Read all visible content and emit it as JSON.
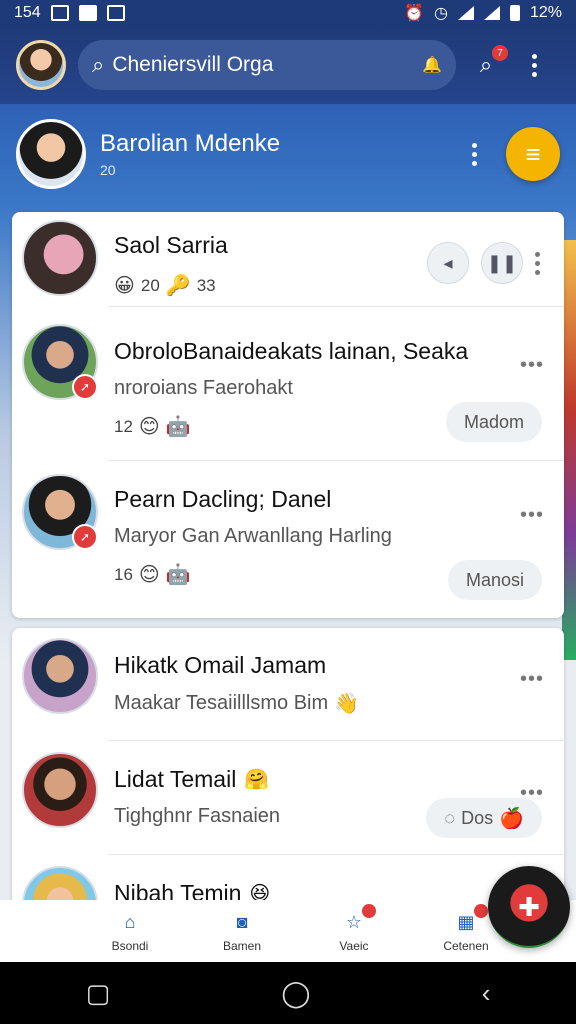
{
  "status_bar": {
    "time": "154",
    "battery_text": "12%"
  },
  "header": {
    "search_text": "Cheniersvill Orga",
    "notification_count": "7"
  },
  "profile": {
    "name": "Barolian Mdenke",
    "subtitle": "20"
  },
  "chats": [
    {
      "title": "Saol Sarria",
      "meta": "20",
      "meta2": "33"
    },
    {
      "title": "ObroloBanaideakats lainan, Seaka",
      "subtitle": "nroroians Faerohakt",
      "meta": "12",
      "pill": "Madom"
    },
    {
      "title": "Pearn Dacling; Danel",
      "subtitle": "Maryor Gan Arwanllang Harling",
      "meta": "16",
      "pill": "Manosi"
    },
    {
      "title": "Hikatk Omail Jamam",
      "subtitle": "Maakar Tesaiilllsmo Bim"
    },
    {
      "title": "Lidat Temail",
      "subtitle": "Tighghnr Fasnaien",
      "pill": "Dos"
    },
    {
      "title": "Nibah Temin"
    }
  ],
  "bottom_nav": {
    "items": [
      {
        "label": "Bsondi",
        "icon": "home-icon"
      },
      {
        "label": "Bamen",
        "icon": "chat-icon"
      },
      {
        "label": "Vaeic",
        "icon": "star-icon"
      },
      {
        "label": "Cetenen",
        "icon": "grid-icon"
      }
    ]
  },
  "colors": {
    "brand": "#1f3a78",
    "accent": "#f4b400",
    "alert": "#e23b3b"
  }
}
